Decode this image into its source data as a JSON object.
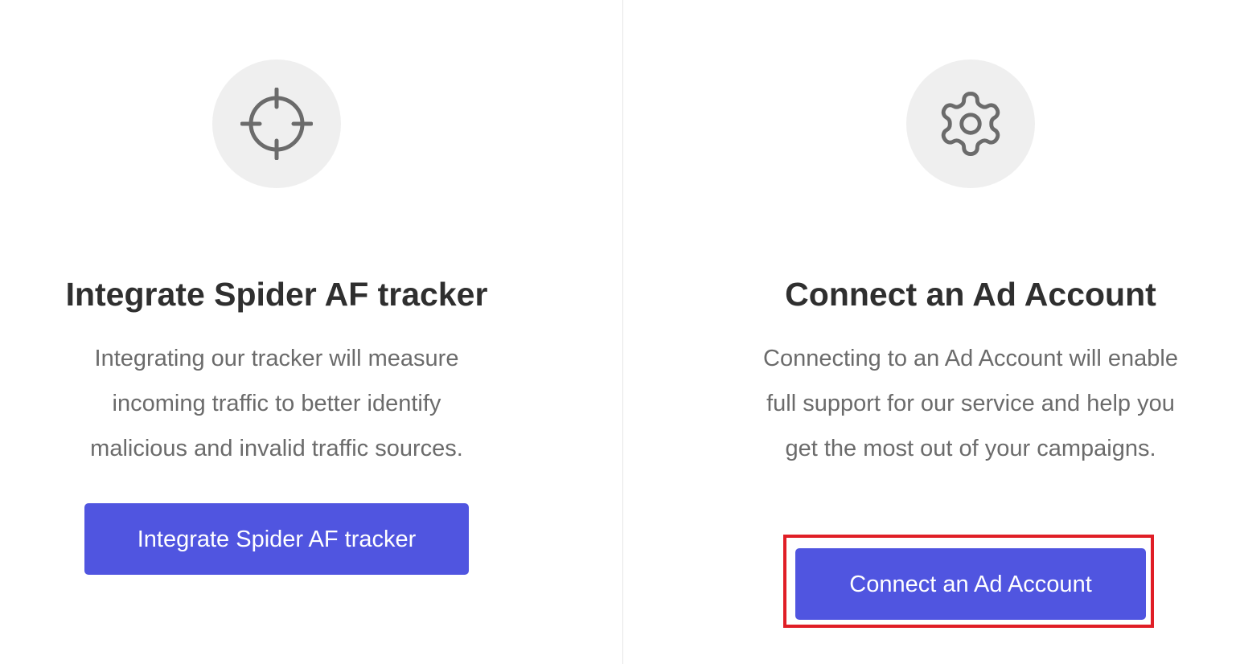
{
  "left_card": {
    "icon": "crosshair-icon",
    "title": "Integrate Spider AF tracker",
    "description": "Integrating our tracker will measure incoming traffic to better identify malicious and invalid traffic sources.",
    "button_label": "Integrate Spider AF tracker"
  },
  "right_card": {
    "icon": "gear-icon",
    "title": "Connect an Ad Account",
    "description": "Connecting to an Ad Account will enable full support for our service and help you get the most out of your campaigns.",
    "button_label": "Connect an Ad Account",
    "highlighted": true
  },
  "colors": {
    "accent": "#5055e0",
    "highlight": "#e01e26",
    "icon_bg": "#efefef",
    "icon_stroke": "#6b6b6b"
  }
}
